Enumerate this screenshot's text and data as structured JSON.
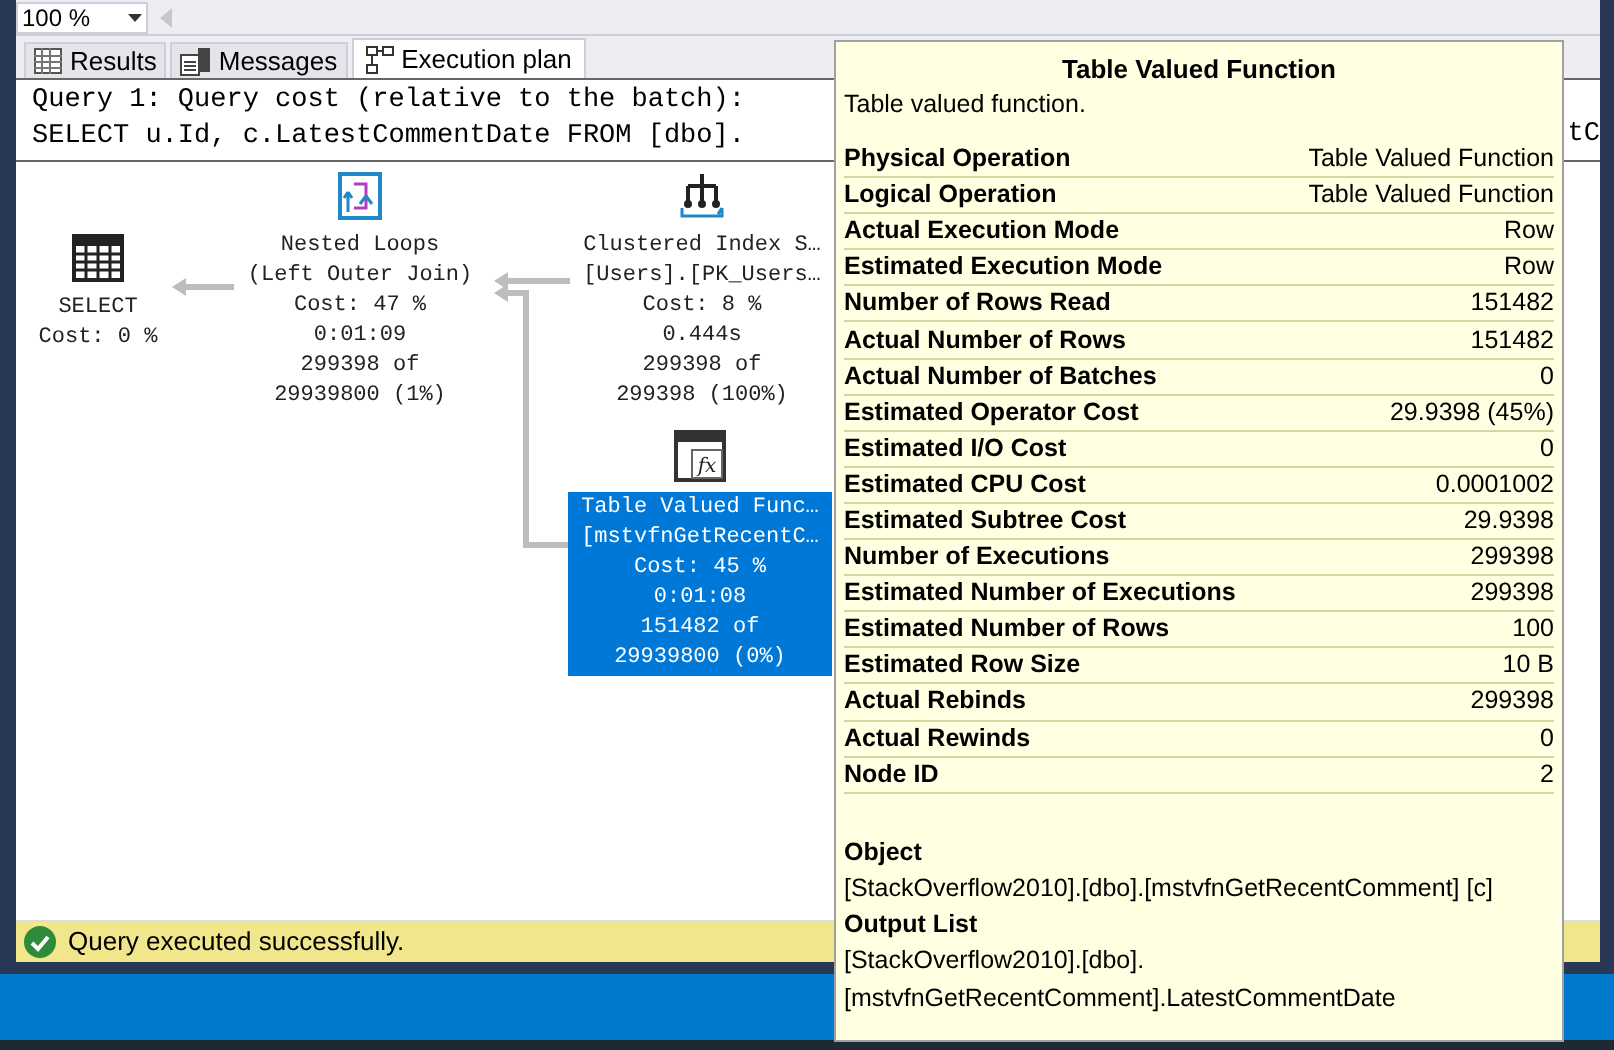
{
  "toolbar": {
    "zoom": "100 %"
  },
  "tabs": [
    {
      "label": "Results",
      "selected": false,
      "kind": "grid"
    },
    {
      "label": "Messages",
      "selected": false,
      "kind": "messages"
    },
    {
      "label": "Execution plan",
      "selected": true,
      "kind": "plan"
    }
  ],
  "query": {
    "header": "Query 1: Query cost (relative to the batch):",
    "statement": "SELECT u.Id, c.LatestCommentDate FROM [dbo].",
    "statement_tail": "tC"
  },
  "plan_nodes": [
    {
      "kind": "select",
      "selected": false,
      "lines": [
        "SELECT",
        "Cost: 0 %"
      ]
    },
    {
      "kind": "nested_loops",
      "selected": false,
      "lines": [
        "Nested Loops",
        "(Left Outer Join)",
        "Cost: 47 %",
        "0:01:09",
        "299398 of",
        "29939800 (1%)"
      ]
    },
    {
      "kind": "clustered_index_seek",
      "selected": false,
      "lines": [
        "Clustered Index S…",
        "[Users].[PK_Users…",
        "Cost: 8 %",
        "0.444s",
        "299398 of",
        "299398 (100%)"
      ]
    },
    {
      "kind": "table_valued_function",
      "selected": true,
      "icon_label": "fx",
      "lines": [
        "Table Valued Func…",
        "[mstvfnGetRecentC…",
        "Cost: 45 %",
        "0:01:08",
        "151482 of",
        "29939800 (0%)"
      ]
    }
  ],
  "tooltip": {
    "title": "Table Valued Function",
    "description": "Table valued function.",
    "properties": [
      {
        "name": "Physical Operation",
        "value": "Table Valued Function"
      },
      {
        "name": "Logical Operation",
        "value": "Table Valued Function"
      },
      {
        "name": "Actual Execution Mode",
        "value": "Row"
      },
      {
        "name": "Estimated Execution Mode",
        "value": "Row"
      },
      {
        "name": "Number of Rows Read",
        "value": "151482"
      },
      {
        "name": "Actual Number of Rows",
        "value": "151482"
      },
      {
        "name": "Actual Number of Batches",
        "value": "0"
      },
      {
        "name": "Estimated Operator Cost",
        "value": "29.9398 (45%)"
      },
      {
        "name": "Estimated I/O Cost",
        "value": "0"
      },
      {
        "name": "Estimated CPU Cost",
        "value": "0.0001002"
      },
      {
        "name": "Estimated Subtree Cost",
        "value": "29.9398"
      },
      {
        "name": "Number of Executions",
        "value": "299398"
      },
      {
        "name": "Estimated Number of Executions",
        "value": "299398"
      },
      {
        "name": "Estimated Number of Rows",
        "value": "100"
      },
      {
        "name": "Estimated Row Size",
        "value": "10 B"
      },
      {
        "name": "Actual Rebinds",
        "value": "299398"
      },
      {
        "name": "Actual Rewinds",
        "value": "0"
      },
      {
        "name": "Node ID",
        "value": "2"
      }
    ],
    "sections": [
      {
        "heading": "Object",
        "lines": [
          "[StackOverflow2010].[dbo].[mstvfnGetRecentComment] [c]"
        ]
      },
      {
        "heading": "Output List",
        "lines": [
          "[StackOverflow2010].[dbo].",
          "[mstvfnGetRecentComment].LatestCommentDate"
        ]
      }
    ]
  },
  "status_bar": {
    "message": "Query executed successfully."
  }
}
